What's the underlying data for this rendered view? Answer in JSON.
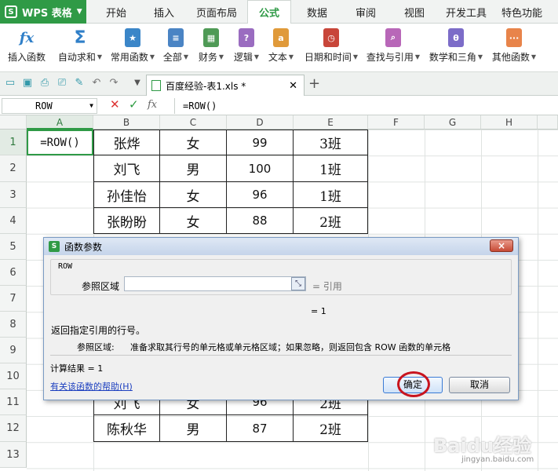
{
  "app": {
    "name": "WPS 表格",
    "logo": "S"
  },
  "menu_tabs": [
    {
      "label": "开始"
    },
    {
      "label": "插入"
    },
    {
      "label": "页面布局"
    },
    {
      "label": "公式",
      "active": true
    },
    {
      "label": "数据"
    },
    {
      "label": "审阅"
    },
    {
      "label": "视图"
    },
    {
      "label": "开发工具"
    },
    {
      "label": "特色功能"
    }
  ],
  "ribbon": [
    {
      "label": "插入函数",
      "icon": "fx-icon"
    },
    {
      "label": "自动求和",
      "icon": "sigma-icon"
    },
    {
      "label": "常用函数",
      "icon": "star-book-icon"
    },
    {
      "label": "全部",
      "icon": "list-book-icon"
    },
    {
      "label": "财务",
      "icon": "finance-book-icon"
    },
    {
      "label": "逻辑",
      "icon": "question-book-icon"
    },
    {
      "label": "文本",
      "icon": "text-book-icon"
    },
    {
      "label": "日期和时间",
      "icon": "clock-book-icon"
    },
    {
      "label": "查找与引用",
      "icon": "search-book-icon"
    },
    {
      "label": "数学和三角",
      "icon": "theta-book-icon"
    },
    {
      "label": "其他函数",
      "icon": "more-book-icon"
    }
  ],
  "doc_tab": {
    "label": "百度经验-表1.xls *"
  },
  "formula_bar": {
    "name_box": "ROW",
    "formula": "=ROW()",
    "fx": "fx"
  },
  "columns": [
    "A",
    "B",
    "C",
    "D",
    "E",
    "F",
    "G",
    "H"
  ],
  "rows": [
    "1",
    "2",
    "3",
    "4",
    "5",
    "6",
    "7",
    "8",
    "9",
    "10",
    "11",
    "12",
    "13"
  ],
  "cells": {
    "A1": "=ROW()",
    "B1": "张烨",
    "C1": "女",
    "D1": "99",
    "E1": "3班",
    "B2": "刘飞",
    "C2": "男",
    "D2": "100",
    "E2": "1班",
    "B3": "孙佳怡",
    "C3": "女",
    "D3": "96",
    "E3": "1班",
    "B4": "张盼盼",
    "C4": "女",
    "D4": "88",
    "E4": "2班",
    "B11": "刘飞",
    "C11": "女",
    "D11": "96",
    "E11": "2班",
    "B12": "陈秋华",
    "C12": "男",
    "D12": "87",
    "E12": "2班"
  },
  "dialog": {
    "title": "函数参数",
    "close": "×",
    "function_name": "ROW",
    "arg_label": "参照区域",
    "arg_value": "",
    "arg_result": "= 引用",
    "function_result": "= 1",
    "description": "返回指定引用的行号。",
    "arg_desc_label": "参照区域:",
    "arg_desc": "准备求取其行号的单元格或单元格区域；如果忽略，则返回包含 ROW 函数的单元格",
    "calc_result": "计算结果 = 1",
    "help_link": "有关该函数的帮助(H)",
    "ok": "确定",
    "cancel": "取消"
  },
  "watermark": {
    "text": "Baidu经验",
    "sub": "jingyan.baidu.com"
  }
}
